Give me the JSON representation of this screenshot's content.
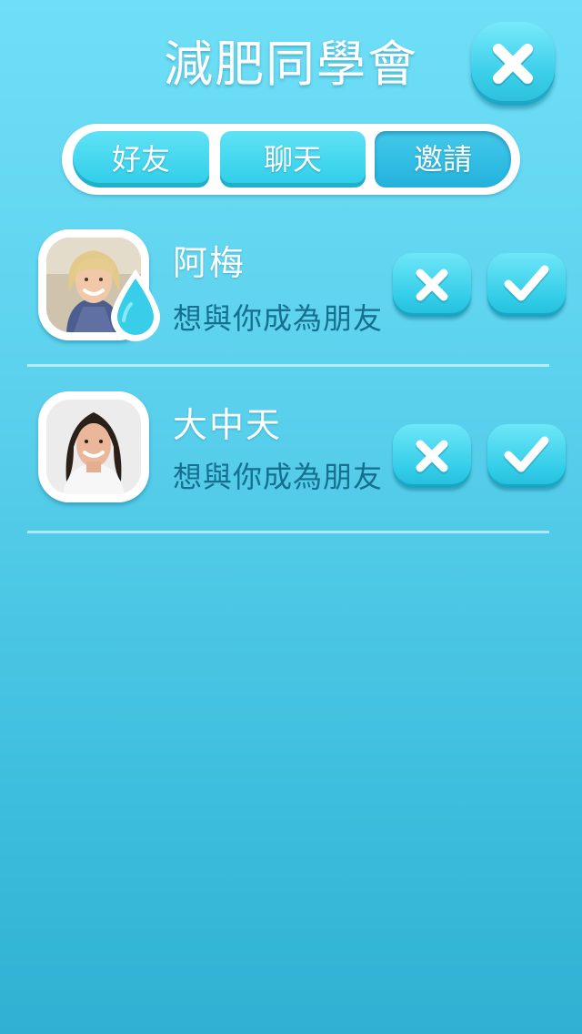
{
  "header": {
    "title": "減肥同學會",
    "close_icon": "close-icon"
  },
  "tabs": [
    {
      "label": "好友",
      "active": false
    },
    {
      "label": "聊天",
      "active": false
    },
    {
      "label": "邀請",
      "active": true
    }
  ],
  "invitations": [
    {
      "name": "阿梅",
      "message": "想與你成為朋友",
      "avatar": "blonde-woman-avatar",
      "badge_icon": "water-drop-icon",
      "decline_icon": "decline-x-icon",
      "accept_icon": "accept-check-icon"
    },
    {
      "name": "大中天",
      "message": "想與你成為朋友",
      "avatar": "brunette-woman-avatar",
      "decline_icon": "decline-x-icon",
      "accept_icon": "accept-check-icon"
    }
  ],
  "colors": {
    "background_top": "#6fdff7",
    "background_bottom": "#2fb1d3",
    "button_cyan": "#33cde8",
    "message_text": "#14708e"
  }
}
